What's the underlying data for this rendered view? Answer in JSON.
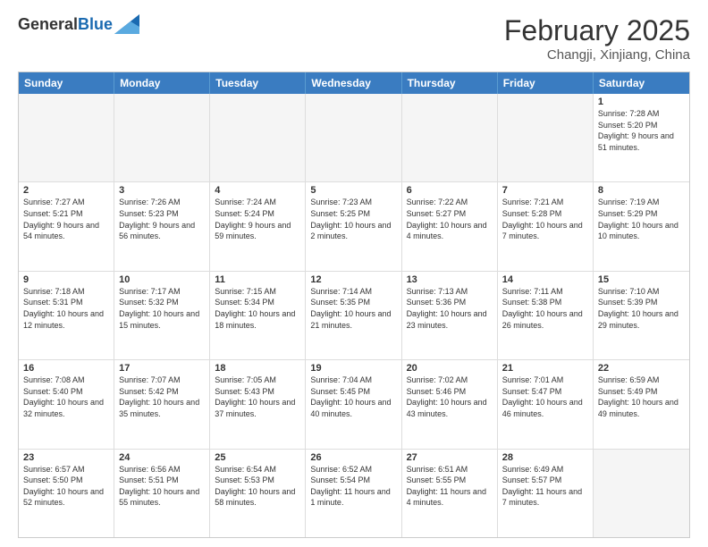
{
  "header": {
    "logo_general": "General",
    "logo_blue": "Blue",
    "month_year": "February 2025",
    "location": "Changji, Xinjiang, China"
  },
  "calendar": {
    "days_of_week": [
      "Sunday",
      "Monday",
      "Tuesday",
      "Wednesday",
      "Thursday",
      "Friday",
      "Saturday"
    ],
    "weeks": [
      [
        {
          "day": "",
          "empty": true
        },
        {
          "day": "",
          "empty": true
        },
        {
          "day": "",
          "empty": true
        },
        {
          "day": "",
          "empty": true
        },
        {
          "day": "",
          "empty": true
        },
        {
          "day": "",
          "empty": true
        },
        {
          "day": "1",
          "info": "Sunrise: 7:28 AM\nSunset: 5:20 PM\nDaylight: 9 hours and 51 minutes."
        }
      ],
      [
        {
          "day": "2",
          "info": "Sunrise: 7:27 AM\nSunset: 5:21 PM\nDaylight: 9 hours and 54 minutes."
        },
        {
          "day": "3",
          "info": "Sunrise: 7:26 AM\nSunset: 5:23 PM\nDaylight: 9 hours and 56 minutes."
        },
        {
          "day": "4",
          "info": "Sunrise: 7:24 AM\nSunset: 5:24 PM\nDaylight: 9 hours and 59 minutes."
        },
        {
          "day": "5",
          "info": "Sunrise: 7:23 AM\nSunset: 5:25 PM\nDaylight: 10 hours and 2 minutes."
        },
        {
          "day": "6",
          "info": "Sunrise: 7:22 AM\nSunset: 5:27 PM\nDaylight: 10 hours and 4 minutes."
        },
        {
          "day": "7",
          "info": "Sunrise: 7:21 AM\nSunset: 5:28 PM\nDaylight: 10 hours and 7 minutes."
        },
        {
          "day": "8",
          "info": "Sunrise: 7:19 AM\nSunset: 5:29 PM\nDaylight: 10 hours and 10 minutes."
        }
      ],
      [
        {
          "day": "9",
          "info": "Sunrise: 7:18 AM\nSunset: 5:31 PM\nDaylight: 10 hours and 12 minutes."
        },
        {
          "day": "10",
          "info": "Sunrise: 7:17 AM\nSunset: 5:32 PM\nDaylight: 10 hours and 15 minutes."
        },
        {
          "day": "11",
          "info": "Sunrise: 7:15 AM\nSunset: 5:34 PM\nDaylight: 10 hours and 18 minutes."
        },
        {
          "day": "12",
          "info": "Sunrise: 7:14 AM\nSunset: 5:35 PM\nDaylight: 10 hours and 21 minutes."
        },
        {
          "day": "13",
          "info": "Sunrise: 7:13 AM\nSunset: 5:36 PM\nDaylight: 10 hours and 23 minutes."
        },
        {
          "day": "14",
          "info": "Sunrise: 7:11 AM\nSunset: 5:38 PM\nDaylight: 10 hours and 26 minutes."
        },
        {
          "day": "15",
          "info": "Sunrise: 7:10 AM\nSunset: 5:39 PM\nDaylight: 10 hours and 29 minutes."
        }
      ],
      [
        {
          "day": "16",
          "info": "Sunrise: 7:08 AM\nSunset: 5:40 PM\nDaylight: 10 hours and 32 minutes."
        },
        {
          "day": "17",
          "info": "Sunrise: 7:07 AM\nSunset: 5:42 PM\nDaylight: 10 hours and 35 minutes."
        },
        {
          "day": "18",
          "info": "Sunrise: 7:05 AM\nSunset: 5:43 PM\nDaylight: 10 hours and 37 minutes."
        },
        {
          "day": "19",
          "info": "Sunrise: 7:04 AM\nSunset: 5:45 PM\nDaylight: 10 hours and 40 minutes."
        },
        {
          "day": "20",
          "info": "Sunrise: 7:02 AM\nSunset: 5:46 PM\nDaylight: 10 hours and 43 minutes."
        },
        {
          "day": "21",
          "info": "Sunrise: 7:01 AM\nSunset: 5:47 PM\nDaylight: 10 hours and 46 minutes."
        },
        {
          "day": "22",
          "info": "Sunrise: 6:59 AM\nSunset: 5:49 PM\nDaylight: 10 hours and 49 minutes."
        }
      ],
      [
        {
          "day": "23",
          "info": "Sunrise: 6:57 AM\nSunset: 5:50 PM\nDaylight: 10 hours and 52 minutes."
        },
        {
          "day": "24",
          "info": "Sunrise: 6:56 AM\nSunset: 5:51 PM\nDaylight: 10 hours and 55 minutes."
        },
        {
          "day": "25",
          "info": "Sunrise: 6:54 AM\nSunset: 5:53 PM\nDaylight: 10 hours and 58 minutes."
        },
        {
          "day": "26",
          "info": "Sunrise: 6:52 AM\nSunset: 5:54 PM\nDaylight: 11 hours and 1 minute."
        },
        {
          "day": "27",
          "info": "Sunrise: 6:51 AM\nSunset: 5:55 PM\nDaylight: 11 hours and 4 minutes."
        },
        {
          "day": "28",
          "info": "Sunrise: 6:49 AM\nSunset: 5:57 PM\nDaylight: 11 hours and 7 minutes."
        },
        {
          "day": "",
          "empty": true
        }
      ]
    ]
  }
}
